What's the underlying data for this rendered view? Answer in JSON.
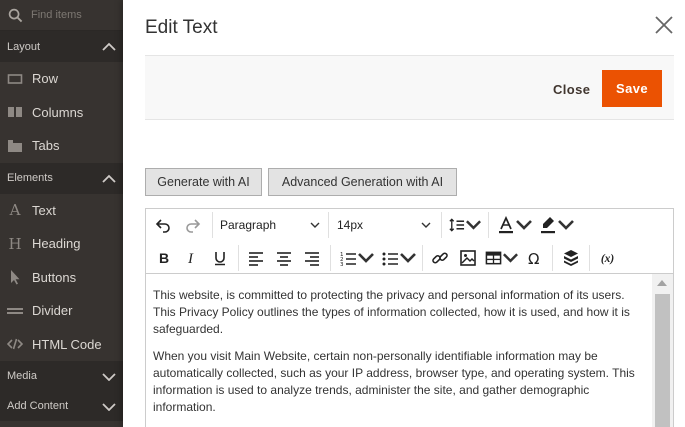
{
  "sidebar": {
    "search_placeholder": "Find items",
    "sections": [
      {
        "label": "Layout",
        "expanded": true
      },
      {
        "label": "Elements",
        "expanded": true
      },
      {
        "label": "Media",
        "expanded": false
      },
      {
        "label": "Add Content",
        "expanded": false
      }
    ],
    "layout_items": [
      {
        "label": "Row",
        "icon": "row-icon"
      },
      {
        "label": "Columns",
        "icon": "columns-icon"
      },
      {
        "label": "Tabs",
        "icon": "tabs-icon"
      }
    ],
    "element_items": [
      {
        "label": "Text",
        "icon": "text-icon"
      },
      {
        "label": "Heading",
        "icon": "heading-icon"
      },
      {
        "label": "Buttons",
        "icon": "cursor-icon"
      },
      {
        "label": "Divider",
        "icon": "divider-icon"
      },
      {
        "label": "HTML Code",
        "icon": "code-icon"
      }
    ]
  },
  "modal": {
    "title": "Edit Text",
    "close_label": "Close",
    "save_label": "Save",
    "ai_buttons": {
      "generate": "Generate with AI",
      "advanced": "Advanced Generation with AI"
    }
  },
  "editor": {
    "block_format": "Paragraph",
    "font_size": "14px",
    "paragraphs": [
      "This website, is committed to protecting the privacy and personal information of its users. This Privacy Policy outlines the types of information collected, how it is used, and how it is safeguarded.",
      "When you visit Main Website, certain non-personally identifiable information may be automatically collected, such as your IP address, browser type, and operating system. This information is used to analyze trends, administer the site, and gather demographic information."
    ]
  },
  "colors": {
    "accent": "#eb5202",
    "sidebar_bg": "#373330",
    "sidebar_header_bg": "#2d2a28"
  }
}
